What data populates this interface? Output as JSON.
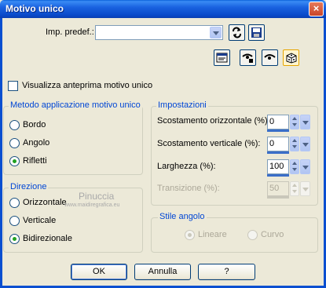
{
  "window": {
    "title": "Motivo unico",
    "close_glyph": "×"
  },
  "preset": {
    "label": "Imp. predef.:",
    "value": ""
  },
  "preview_checkbox": {
    "label": "Visualizza anteprima motivo unico",
    "checked": false
  },
  "method_group": {
    "title": "Metodo applicazione motivo unico",
    "options": [
      {
        "label": "Bordo",
        "checked": false
      },
      {
        "label": "Angolo",
        "checked": false
      },
      {
        "label": "Rifletti",
        "checked": true
      }
    ]
  },
  "direction_group": {
    "title": "Direzione",
    "options": [
      {
        "label": "Orizzontale",
        "checked": false
      },
      {
        "label": "Verticale",
        "checked": false
      },
      {
        "label": "Bidirezionale",
        "checked": true
      }
    ]
  },
  "settings_group": {
    "title": "Impostazioni",
    "fields": [
      {
        "label": "Scostamento orizzontale (%):",
        "value": "0",
        "enabled": true
      },
      {
        "label": "Scostamento verticale (%):",
        "value": "0",
        "enabled": true
      },
      {
        "label": "Larghezza (%):",
        "value": "100",
        "enabled": true
      },
      {
        "label": "Transizione (%):",
        "value": "50",
        "enabled": false
      }
    ]
  },
  "corner_group": {
    "title": "Stile angolo",
    "options": [
      {
        "label": "Lineare",
        "checked": true,
        "enabled": false
      },
      {
        "label": "Curvo",
        "checked": false,
        "enabled": false
      }
    ]
  },
  "watermark": {
    "text": "Pinuccia",
    "url": "www.maidiregrafica.eu"
  },
  "buttons": {
    "ok": "OK",
    "cancel": "Annulla",
    "help": "?"
  },
  "colors": {
    "title_bar": "#0a5fd9",
    "group_title": "#0046d5",
    "dialog_bg": "#ece9d8",
    "radio_checked": "#21a121"
  }
}
